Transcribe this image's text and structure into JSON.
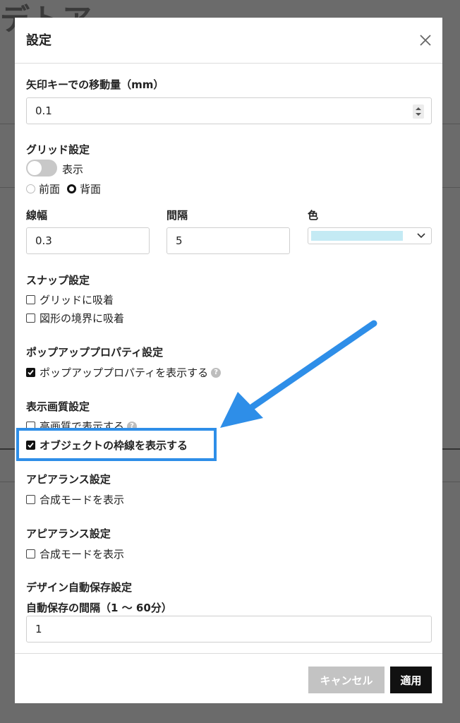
{
  "background": {
    "title_fragment": "デトア"
  },
  "dialog": {
    "title": "設定",
    "close_icon": "close-icon",
    "arrow_section": {
      "label": "矢印キーでの移動量（mm）",
      "value": "0.1"
    },
    "grid": {
      "label": "グリッド設定",
      "toggle_label": "表示",
      "toggle_on": false,
      "radio_front": "前面",
      "radio_back": "背面",
      "selected": "背面",
      "width_label": "線幅",
      "width_value": "0.3",
      "interval_label": "間隔",
      "interval_value": "5",
      "color_label": "色",
      "color_value": "#c4eaf4"
    },
    "snap": {
      "label": "スナップ設定",
      "grid_option": "グリッドに吸着",
      "shape_option": "図形の境界に吸着"
    },
    "popup": {
      "label": "ポップアッププロパティ設定",
      "option": "ポップアッププロパティを表示する",
      "help": "?"
    },
    "quality": {
      "label": "表示画質設定",
      "high_quality_option": "高画質で表示する",
      "help": "?",
      "border_option": "オブジェクトの枠線を表示する"
    },
    "appearance1": {
      "label": "アピアランス設定",
      "option": "合成モードを表示"
    },
    "appearance2": {
      "label": "アピアランス設定",
      "option": "合成モードを表示"
    },
    "autosave": {
      "label": "デザイン自動保存設定",
      "interval_label": "自動保存の間隔（1 〜 60分）",
      "interval_value": "1"
    },
    "footer": {
      "cancel_label": "キャンセル",
      "apply_label": "適用"
    }
  },
  "annotation": {
    "highlight_color": "#2e8ee8"
  }
}
